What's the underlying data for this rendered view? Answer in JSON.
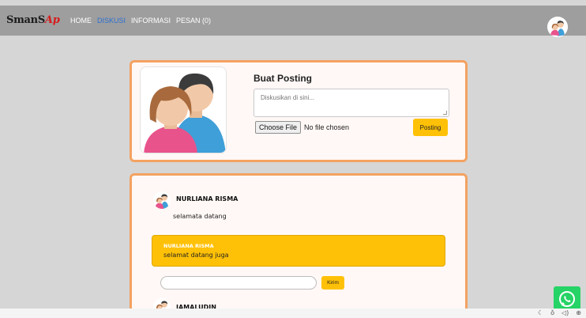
{
  "navbar": {
    "brand_main": "SmanS",
    "brand_accent": "Ap",
    "links": [
      {
        "label": "HOME"
      },
      {
        "label": "DISKUSI"
      },
      {
        "label": "INFORMASI"
      },
      {
        "label": "PESAN (0)"
      }
    ],
    "active_link": "DISKUSI",
    "avatar_icon": "users-icon"
  },
  "post_card": {
    "title": "Buat Posting",
    "textarea_placeholder": "Diskusikan di sini...",
    "file_button": "Choose File",
    "file_status": "No file chosen",
    "submit_label": "Posting"
  },
  "discussion": {
    "comments": [
      {
        "author": "NURLIANA RISMA",
        "text": "selamata datang"
      },
      {
        "author": "JAMALUDIN"
      }
    ],
    "reply": {
      "author": "NURLIANA RISMA",
      "text": "selamat datang juga"
    },
    "reply_input_value": "",
    "reply_button": "Kirim"
  },
  "floating": {
    "whatsapp_icon": "whatsapp-icon"
  },
  "tray_icons": [
    "moon-icon",
    "lock-icon",
    "speaker-icon",
    "zoom-icon"
  ],
  "colors": {
    "navbar": "#9e9e9e",
    "background": "#d6d6d6",
    "card_border": "#f4a261",
    "accent": "#ffc107",
    "active_link": "#2c6fd1",
    "brand_accent": "#d81b1b",
    "whatsapp": "#25d366"
  }
}
